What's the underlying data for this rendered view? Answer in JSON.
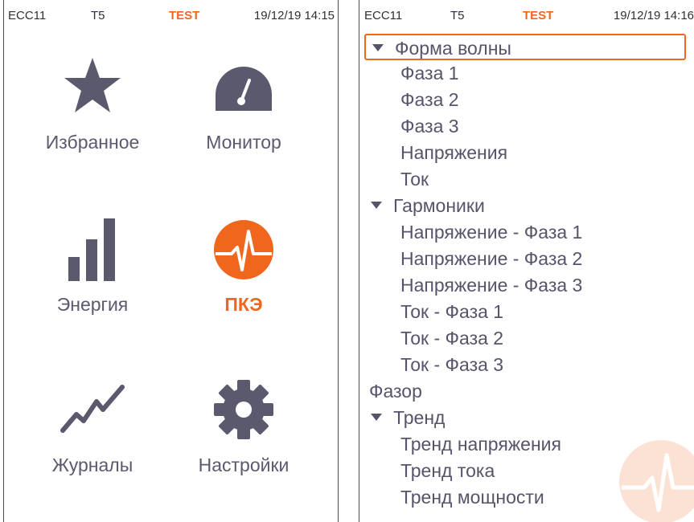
{
  "left_screen": {
    "status": {
      "device": "ECC11",
      "unit": "T5",
      "mode": "TEST",
      "datetime": "19/12/19 14:15"
    },
    "tiles": [
      {
        "label": "Избранное",
        "icon": "star-icon"
      },
      {
        "label": "Монитор",
        "icon": "gauge-icon"
      },
      {
        "label": "Энергия",
        "icon": "bar-chart-icon"
      },
      {
        "label": "ПКЭ",
        "icon": "pulse-wave-icon",
        "active": true
      },
      {
        "label": "Журналы",
        "icon": "trend-line-icon"
      },
      {
        "label": "Настройки",
        "icon": "gear-icon"
      }
    ]
  },
  "right_screen": {
    "status": {
      "device": "ECC11",
      "unit": "T5",
      "mode": "TEST",
      "datetime": "19/12/19 14:16"
    },
    "tree": [
      {
        "label": "Форма волны",
        "level": 1,
        "expanded": true,
        "selected": true
      },
      {
        "label": "Фаза 1",
        "level": 2
      },
      {
        "label": "Фаза 2",
        "level": 2
      },
      {
        "label": "Фаза 3",
        "level": 2
      },
      {
        "label": "Напряжения",
        "level": 2
      },
      {
        "label": "Ток",
        "level": 2
      },
      {
        "label": "Гармоники",
        "level": 1,
        "expanded": true
      },
      {
        "label": "Напряжение - Фаза 1",
        "level": 2
      },
      {
        "label": "Напряжение - Фаза 2",
        "level": 2
      },
      {
        "label": "Напряжение - Фаза 3",
        "level": 2
      },
      {
        "label": "Ток - Фаза 1",
        "level": 2
      },
      {
        "label": "Ток - Фаза 2",
        "level": 2
      },
      {
        "label": "Ток - Фаза 3",
        "level": 2
      },
      {
        "label": "Фазор",
        "level": 1,
        "expanded": false
      },
      {
        "label": "Тренд",
        "level": 1,
        "expanded": true
      },
      {
        "label": "Тренд напряжения",
        "level": 2
      },
      {
        "label": "Тренд тока",
        "level": 2
      },
      {
        "label": "Тренд мощности",
        "level": 2
      }
    ]
  },
  "colors": {
    "accent": "#f0661d",
    "icon": "#5a596e",
    "text": "#55546a"
  }
}
